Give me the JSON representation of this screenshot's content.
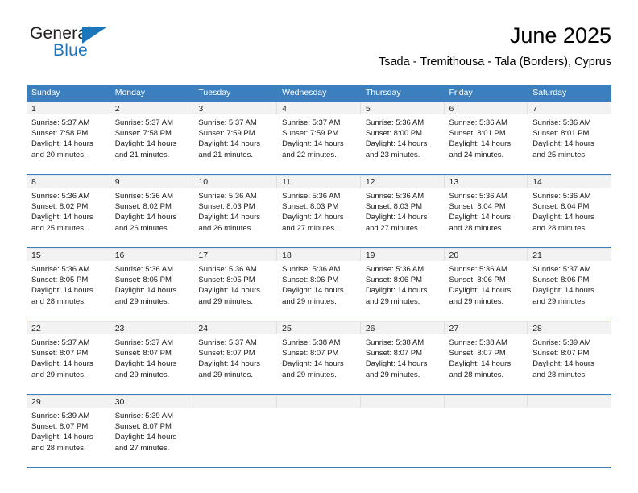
{
  "logo": {
    "word_top": "General",
    "word_bottom": "Blue",
    "accent_color": "#1c76bc",
    "triangle_icon": "triangle-icon"
  },
  "header": {
    "title": "June 2025",
    "subtitle": "Tsada - Tremithousa - Tala (Borders), Cyprus"
  },
  "theme": {
    "header_blue": "#3b7fbf",
    "daynum_gray": "#f2f2f2",
    "text": "#1a1a1a"
  },
  "weekday_headers": [
    "Sunday",
    "Monday",
    "Tuesday",
    "Wednesday",
    "Thursday",
    "Friday",
    "Saturday"
  ],
  "weeks": [
    [
      {
        "day": "1",
        "sunrise": "Sunrise: 5:37 AM",
        "sunset": "Sunset: 7:58 PM",
        "daylight_1": "Daylight: 14 hours",
        "daylight_2": "and 20 minutes."
      },
      {
        "day": "2",
        "sunrise": "Sunrise: 5:37 AM",
        "sunset": "Sunset: 7:58 PM",
        "daylight_1": "Daylight: 14 hours",
        "daylight_2": "and 21 minutes."
      },
      {
        "day": "3",
        "sunrise": "Sunrise: 5:37 AM",
        "sunset": "Sunset: 7:59 PM",
        "daylight_1": "Daylight: 14 hours",
        "daylight_2": "and 21 minutes."
      },
      {
        "day": "4",
        "sunrise": "Sunrise: 5:37 AM",
        "sunset": "Sunset: 7:59 PM",
        "daylight_1": "Daylight: 14 hours",
        "daylight_2": "and 22 minutes."
      },
      {
        "day": "5",
        "sunrise": "Sunrise: 5:36 AM",
        "sunset": "Sunset: 8:00 PM",
        "daylight_1": "Daylight: 14 hours",
        "daylight_2": "and 23 minutes."
      },
      {
        "day": "6",
        "sunrise": "Sunrise: 5:36 AM",
        "sunset": "Sunset: 8:01 PM",
        "daylight_1": "Daylight: 14 hours",
        "daylight_2": "and 24 minutes."
      },
      {
        "day": "7",
        "sunrise": "Sunrise: 5:36 AM",
        "sunset": "Sunset: 8:01 PM",
        "daylight_1": "Daylight: 14 hours",
        "daylight_2": "and 25 minutes."
      }
    ],
    [
      {
        "day": "8",
        "sunrise": "Sunrise: 5:36 AM",
        "sunset": "Sunset: 8:02 PM",
        "daylight_1": "Daylight: 14 hours",
        "daylight_2": "and 25 minutes."
      },
      {
        "day": "9",
        "sunrise": "Sunrise: 5:36 AM",
        "sunset": "Sunset: 8:02 PM",
        "daylight_1": "Daylight: 14 hours",
        "daylight_2": "and 26 minutes."
      },
      {
        "day": "10",
        "sunrise": "Sunrise: 5:36 AM",
        "sunset": "Sunset: 8:03 PM",
        "daylight_1": "Daylight: 14 hours",
        "daylight_2": "and 26 minutes."
      },
      {
        "day": "11",
        "sunrise": "Sunrise: 5:36 AM",
        "sunset": "Sunset: 8:03 PM",
        "daylight_1": "Daylight: 14 hours",
        "daylight_2": "and 27 minutes."
      },
      {
        "day": "12",
        "sunrise": "Sunrise: 5:36 AM",
        "sunset": "Sunset: 8:03 PM",
        "daylight_1": "Daylight: 14 hours",
        "daylight_2": "and 27 minutes."
      },
      {
        "day": "13",
        "sunrise": "Sunrise: 5:36 AM",
        "sunset": "Sunset: 8:04 PM",
        "daylight_1": "Daylight: 14 hours",
        "daylight_2": "and 28 minutes."
      },
      {
        "day": "14",
        "sunrise": "Sunrise: 5:36 AM",
        "sunset": "Sunset: 8:04 PM",
        "daylight_1": "Daylight: 14 hours",
        "daylight_2": "and 28 minutes."
      }
    ],
    [
      {
        "day": "15",
        "sunrise": "Sunrise: 5:36 AM",
        "sunset": "Sunset: 8:05 PM",
        "daylight_1": "Daylight: 14 hours",
        "daylight_2": "and 28 minutes."
      },
      {
        "day": "16",
        "sunrise": "Sunrise: 5:36 AM",
        "sunset": "Sunset: 8:05 PM",
        "daylight_1": "Daylight: 14 hours",
        "daylight_2": "and 29 minutes."
      },
      {
        "day": "17",
        "sunrise": "Sunrise: 5:36 AM",
        "sunset": "Sunset: 8:05 PM",
        "daylight_1": "Daylight: 14 hours",
        "daylight_2": "and 29 minutes."
      },
      {
        "day": "18",
        "sunrise": "Sunrise: 5:36 AM",
        "sunset": "Sunset: 8:06 PM",
        "daylight_1": "Daylight: 14 hours",
        "daylight_2": "and 29 minutes."
      },
      {
        "day": "19",
        "sunrise": "Sunrise: 5:36 AM",
        "sunset": "Sunset: 8:06 PM",
        "daylight_1": "Daylight: 14 hours",
        "daylight_2": "and 29 minutes."
      },
      {
        "day": "20",
        "sunrise": "Sunrise: 5:36 AM",
        "sunset": "Sunset: 8:06 PM",
        "daylight_1": "Daylight: 14 hours",
        "daylight_2": "and 29 minutes."
      },
      {
        "day": "21",
        "sunrise": "Sunrise: 5:37 AM",
        "sunset": "Sunset: 8:06 PM",
        "daylight_1": "Daylight: 14 hours",
        "daylight_2": "and 29 minutes."
      }
    ],
    [
      {
        "day": "22",
        "sunrise": "Sunrise: 5:37 AM",
        "sunset": "Sunset: 8:07 PM",
        "daylight_1": "Daylight: 14 hours",
        "daylight_2": "and 29 minutes."
      },
      {
        "day": "23",
        "sunrise": "Sunrise: 5:37 AM",
        "sunset": "Sunset: 8:07 PM",
        "daylight_1": "Daylight: 14 hours",
        "daylight_2": "and 29 minutes."
      },
      {
        "day": "24",
        "sunrise": "Sunrise: 5:37 AM",
        "sunset": "Sunset: 8:07 PM",
        "daylight_1": "Daylight: 14 hours",
        "daylight_2": "and 29 minutes."
      },
      {
        "day": "25",
        "sunrise": "Sunrise: 5:38 AM",
        "sunset": "Sunset: 8:07 PM",
        "daylight_1": "Daylight: 14 hours",
        "daylight_2": "and 29 minutes."
      },
      {
        "day": "26",
        "sunrise": "Sunrise: 5:38 AM",
        "sunset": "Sunset: 8:07 PM",
        "daylight_1": "Daylight: 14 hours",
        "daylight_2": "and 29 minutes."
      },
      {
        "day": "27",
        "sunrise": "Sunrise: 5:38 AM",
        "sunset": "Sunset: 8:07 PM",
        "daylight_1": "Daylight: 14 hours",
        "daylight_2": "and 28 minutes."
      },
      {
        "day": "28",
        "sunrise": "Sunrise: 5:39 AM",
        "sunset": "Sunset: 8:07 PM",
        "daylight_1": "Daylight: 14 hours",
        "daylight_2": "and 28 minutes."
      }
    ],
    [
      {
        "day": "29",
        "sunrise": "Sunrise: 5:39 AM",
        "sunset": "Sunset: 8:07 PM",
        "daylight_1": "Daylight: 14 hours",
        "daylight_2": "and 28 minutes."
      },
      {
        "day": "30",
        "sunrise": "Sunrise: 5:39 AM",
        "sunset": "Sunset: 8:07 PM",
        "daylight_1": "Daylight: 14 hours",
        "daylight_2": "and 27 minutes."
      },
      {
        "day": "",
        "sunrise": "",
        "sunset": "",
        "daylight_1": "",
        "daylight_2": ""
      },
      {
        "day": "",
        "sunrise": "",
        "sunset": "",
        "daylight_1": "",
        "daylight_2": ""
      },
      {
        "day": "",
        "sunrise": "",
        "sunset": "",
        "daylight_1": "",
        "daylight_2": ""
      },
      {
        "day": "",
        "sunrise": "",
        "sunset": "",
        "daylight_1": "",
        "daylight_2": ""
      },
      {
        "day": "",
        "sunrise": "",
        "sunset": "",
        "daylight_1": "",
        "daylight_2": ""
      }
    ]
  ]
}
